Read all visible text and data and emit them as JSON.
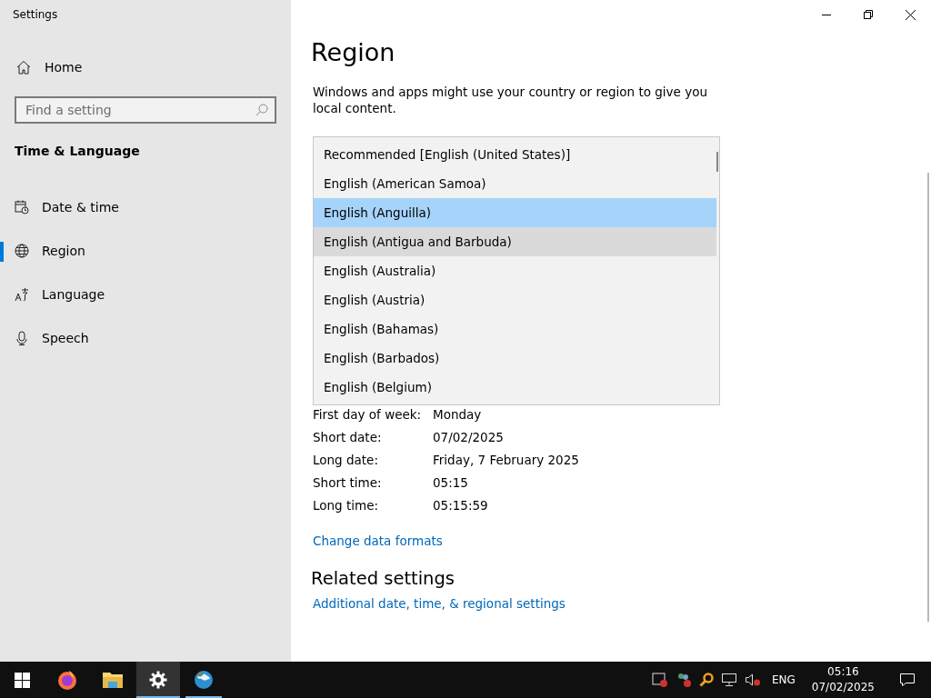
{
  "window": {
    "title": "Settings"
  },
  "sidebar": {
    "home": "Home",
    "search": {
      "placeholder": "Find a setting"
    },
    "section": "Time & Language",
    "items": [
      {
        "label": "Date & time",
        "kind": "calendar",
        "selected": false
      },
      {
        "label": "Region",
        "kind": "globe",
        "selected": true
      },
      {
        "label": "Language",
        "kind": "language",
        "selected": false
      },
      {
        "label": "Speech",
        "kind": "microphone",
        "selected": false
      }
    ]
  },
  "page": {
    "heading": "Region",
    "description": "Windows and apps might use your country or region to give you local content.",
    "dropdown": {
      "options": [
        {
          "label": "Recommended [English (United States)]",
          "selected": false,
          "hovered": false
        },
        {
          "label": "English (American Samoa)",
          "selected": false,
          "hovered": false
        },
        {
          "label": "English (Anguilla)",
          "selected": true,
          "hovered": false
        },
        {
          "label": "English (Antigua and Barbuda)",
          "selected": false,
          "hovered": true
        },
        {
          "label": "English (Australia)",
          "selected": false,
          "hovered": false
        },
        {
          "label": "English (Austria)",
          "selected": false,
          "hovered": false
        },
        {
          "label": "English (Bahamas)",
          "selected": false,
          "hovered": false
        },
        {
          "label": "English (Barbados)",
          "selected": false,
          "hovered": false
        },
        {
          "label": "English (Belgium)",
          "selected": false,
          "hovered": false
        }
      ]
    },
    "formats": [
      {
        "label": "First day of week:",
        "value": "Monday"
      },
      {
        "label": "Short date:",
        "value": "07/02/2025"
      },
      {
        "label": "Long date:",
        "value": "Friday, 7 February 2025"
      },
      {
        "label": "Short time:",
        "value": "05:15"
      },
      {
        "label": "Long time:",
        "value": "05:15:59"
      }
    ],
    "change_link": "Change data formats",
    "related_heading": "Related settings",
    "related_link": "Additional date, time, & regional settings"
  },
  "taskbar": {
    "apps": [
      {
        "kind": "start",
        "active": false,
        "running": false
      },
      {
        "kind": "firefox",
        "active": false,
        "running": false
      },
      {
        "kind": "folder",
        "active": false,
        "running": false
      },
      {
        "kind": "settings",
        "active": true,
        "running": true
      },
      {
        "kind": "globe",
        "active": false,
        "running": true
      }
    ],
    "tray": {
      "language": "ENG",
      "time": "05:16",
      "date": "07/02/2025"
    }
  }
}
